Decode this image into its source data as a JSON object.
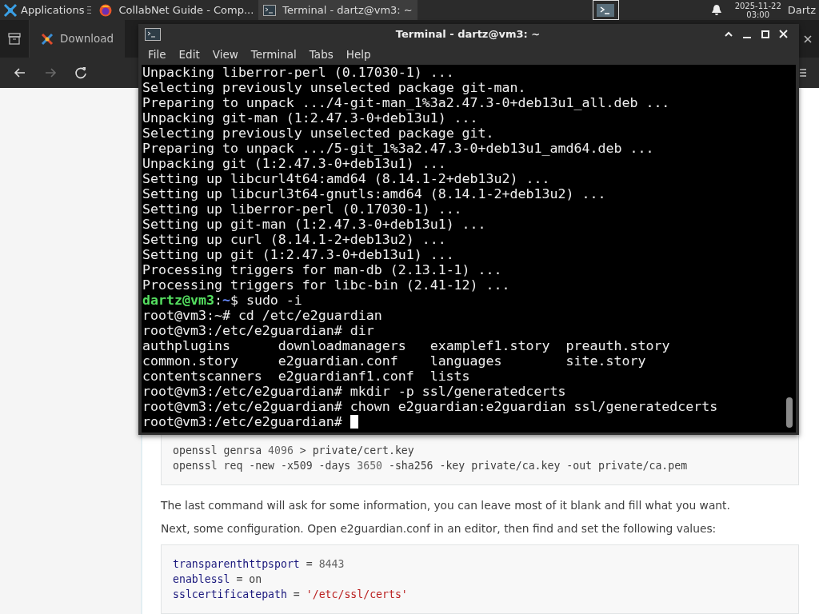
{
  "taskbar": {
    "apps_menu": "Applications",
    "tasks": [
      {
        "kind": "browser",
        "title": "CollabNet Guide - Comp...",
        "selected": false
      },
      {
        "kind": "terminal",
        "title": "Terminal - dartz@vm3: ~",
        "selected": true
      }
    ],
    "date": "2025-11-22",
    "time": "03:00",
    "user": "Dartz"
  },
  "browser": {
    "tabs": [
      {
        "label": "Download",
        "selected": true
      }
    ],
    "nav_buttons": [
      {
        "kind": "back",
        "disabled": false
      },
      {
        "kind": "forward",
        "disabled": true
      },
      {
        "kind": "reload",
        "disabled": false
      }
    ],
    "page": [
      {
        "kind": "code",
        "lines": [
          [
            {
              "kind": "plain",
              "text": "openssl genrsa "
            },
            {
              "kind": "number",
              "text": "4096"
            },
            {
              "kind": "plain",
              "text": " > private/cert.key"
            }
          ],
          [
            {
              "kind": "plain",
              "text": "openssl req -new -x509 -days "
            },
            {
              "kind": "number",
              "text": "3650"
            },
            {
              "kind": "plain",
              "text": " -sha256 -key private/ca.key -out private/ca.pem"
            }
          ]
        ]
      },
      {
        "kind": "paragraph",
        "text": "The last command will ask for some information, you can leave most of it blank and fill what you want."
      },
      {
        "kind": "paragraph",
        "text": "Next, some configuration. Open e2guardian.conf in an editor, then find and set the following values:"
      },
      {
        "kind": "code",
        "lines": [
          [
            {
              "kind": "key",
              "text": "transparenthttpsport"
            },
            {
              "kind": "plain",
              "text": " = "
            },
            {
              "kind": "number",
              "text": "8443"
            }
          ],
          [
            {
              "kind": "key",
              "text": "enablessl"
            },
            {
              "kind": "plain",
              "text": " = on"
            }
          ],
          [
            {
              "kind": "key",
              "text": "sslcertificatepath"
            },
            {
              "kind": "plain",
              "text": " = "
            },
            {
              "kind": "string",
              "text": "'/etc/ssl/certs'"
            }
          ]
        ]
      }
    ]
  },
  "terminal": {
    "title": "Terminal - dartz@vm3: ~",
    "menu": [
      "File",
      "Edit",
      "View",
      "Terminal",
      "Tabs",
      "Help"
    ],
    "lines": [
      {
        "kind": "output",
        "text": "Unpacking liberror-perl (0.17030-1) ..."
      },
      {
        "kind": "output",
        "text": "Selecting previously unselected package git-man."
      },
      {
        "kind": "output",
        "text": "Preparing to unpack .../4-git-man_1%3a2.47.3-0+deb13u1_all.deb ..."
      },
      {
        "kind": "output",
        "text": "Unpacking git-man (1:2.47.3-0+deb13u1) ..."
      },
      {
        "kind": "output",
        "text": "Selecting previously unselected package git."
      },
      {
        "kind": "output",
        "text": "Preparing to unpack .../5-git_1%3a2.47.3-0+deb13u1_amd64.deb ..."
      },
      {
        "kind": "output",
        "text": "Unpacking git (1:2.47.3-0+deb13u1) ..."
      },
      {
        "kind": "output",
        "text": "Setting up libcurl4t64:amd64 (8.14.1-2+deb13u2) ..."
      },
      {
        "kind": "output",
        "text": "Setting up libcurl3t64-gnutls:amd64 (8.14.1-2+deb13u2) ..."
      },
      {
        "kind": "output",
        "text": "Setting up liberror-perl (0.17030-1) ..."
      },
      {
        "kind": "output",
        "text": "Setting up git-man (1:2.47.3-0+deb13u1) ..."
      },
      {
        "kind": "output",
        "text": "Setting up curl (8.14.1-2+deb13u2) ..."
      },
      {
        "kind": "output",
        "text": "Setting up git (1:2.47.3-0+deb13u1) ..."
      },
      {
        "kind": "output",
        "text": "Processing triggers for man-db (2.13.1-1) ..."
      },
      {
        "kind": "output",
        "text": "Processing triggers for libc-bin (2.41-12) ..."
      },
      {
        "kind": "user_prompt",
        "user": "dartz@vm3",
        "separator": ":",
        "path": "~",
        "rest": "$ sudo -i"
      },
      {
        "kind": "output",
        "text": "root@vm3:~# cd /etc/e2guardian"
      },
      {
        "kind": "output",
        "text": "root@vm3:/etc/e2guardian# dir"
      },
      {
        "kind": "columns",
        "cells": [
          "authplugins",
          "downloadmanagers",
          "examplef1.story",
          "preauth.story"
        ]
      },
      {
        "kind": "columns",
        "cells": [
          "common.story",
          "e2guardian.conf",
          "languages",
          "site.story"
        ]
      },
      {
        "kind": "columns",
        "cells": [
          "contentscanners",
          "e2guardianf1.conf",
          "lists"
        ]
      },
      {
        "kind": "output",
        "text": "root@vm3:/etc/e2guardian# mkdir -p ssl/generatedcerts"
      },
      {
        "kind": "output",
        "text": "root@vm3:/etc/e2guardian# chown e2guardian:e2guardian ssl/generatedcerts"
      },
      {
        "kind": "cursor_line",
        "text": "root@vm3:/etc/e2guardian# "
      }
    ]
  }
}
